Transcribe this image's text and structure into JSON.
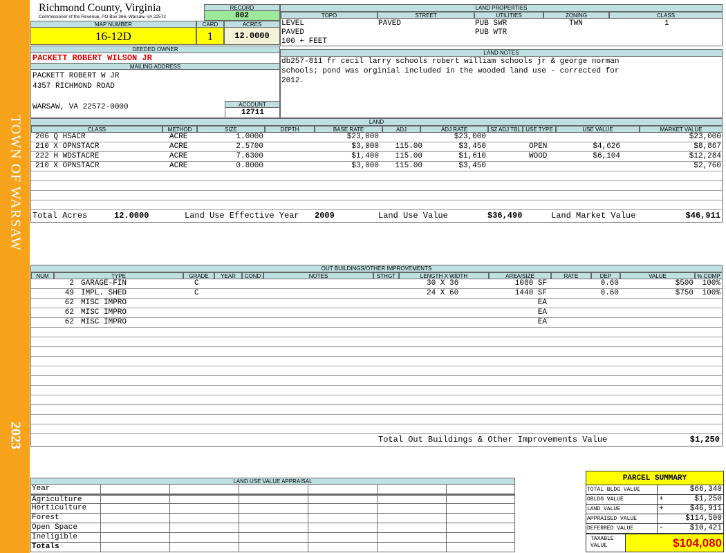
{
  "banner": {
    "town": "TOWN OF WARSAW",
    "year": "2023"
  },
  "header": {
    "county": "Richmond County, Virginia",
    "address": "Commissioner of the Revenue, PO Box 366, Warsaw, VA 22572",
    "record_label": "RECORD",
    "record": "802",
    "map_number_label": "MAP NUMBER",
    "map_number": "16-12D",
    "card_label": "CARD",
    "card": "1",
    "acres_label": "ACRES",
    "acres": "12.0000"
  },
  "owner": {
    "deeded_label": "DEEDED OWNER",
    "name": "PACKETT ROBERT WILSON JR",
    "mailing_label": "MAILING ADDRESS",
    "line1": "PACKETT ROBERT W JR",
    "line2": "4357 RICHMOND ROAD",
    "line3": "WARSAW, VA 22572-0000",
    "account_label": "ACCOUNT",
    "account": "12711"
  },
  "land_properties": {
    "label": "LAND PROPERTIES",
    "headers": [
      "TOPO",
      "STREET",
      "UTILITIES",
      "ZONING",
      "CLASS"
    ],
    "topo": [
      "LEVEL",
      "PAVED",
      "100 + FEET"
    ],
    "street": "PAVED",
    "utilities": [
      "PUB SWR",
      "PUB WTR"
    ],
    "zoning": "TWN",
    "class": "1"
  },
  "land_notes": {
    "label": "LAND NOTES",
    "lines": [
      "db257-811 fr cecil larry schools robert william schools jr & george norman",
      "schools; pond was orginial included in the wooded land use - corrected for",
      "2012."
    ]
  },
  "land": {
    "label": "LAND",
    "headers": [
      "CLASS",
      "METHOD",
      "SIZE",
      "DEPTH",
      "BASE RATE",
      "ADJ",
      "ADJ RATE",
      "SZ ADJ TBL",
      "USE TYPE",
      "USE VALUE",
      "MARKET VALUE"
    ],
    "rows": [
      {
        "class": "206 Q HSACR",
        "method": "ACRE",
        "size": "1.0000",
        "depth": "",
        "base": "$23,000",
        "adj": "",
        "adjrate": "$23,000",
        "sz": "",
        "usetype": "",
        "usevalue": "",
        "market": "$23,000"
      },
      {
        "class": "210 X OPNSTACR",
        "method": "ACRE",
        "size": "2.5700",
        "depth": "",
        "base": "$3,000",
        "adj": "115.00",
        "adjrate": "$3,450",
        "sz": "",
        "usetype": "OPEN",
        "usevalue": "$4,626",
        "market": "$8,867"
      },
      {
        "class": "222 H WDSTACRE",
        "method": "ACRE",
        "size": "7.6300",
        "depth": "",
        "base": "$1,400",
        "adj": "115.00",
        "adjrate": "$1,610",
        "sz": "",
        "usetype": "WOOD",
        "usevalue": "$6,104",
        "market": "$12,284"
      },
      {
        "class": "210 X OPNSTACR",
        "method": "ACRE",
        "size": "0.8000",
        "depth": "",
        "base": "$3,000",
        "adj": "115.00",
        "adjrate": "$3,450",
        "sz": "",
        "usetype": "",
        "usevalue": "",
        "market": "$2,760"
      }
    ],
    "totals": {
      "acres_label": "Total Acres",
      "acres": "12.0000",
      "eff_year_label": "Land Use Effective Year",
      "eff_year": "2009",
      "use_value_label": "Land Use Value",
      "use_value": "$36,490",
      "market_label": "Land Market Value",
      "market": "$46,911"
    }
  },
  "outbuildings": {
    "label": "OUT BUILDINGS/OTHER IMPROVEMENTS",
    "headers": [
      "NUM",
      "TYPE",
      "GRADE",
      "YEAR",
      "COND",
      "NOTES",
      "STHGT",
      "LENGTH X WIDTH",
      "AREA/SIZE",
      "RATE",
      "DEP",
      "VALUE",
      "% COMP"
    ],
    "rows": [
      {
        "num": "2",
        "type": "GARAGE-FIN",
        "grade": "C",
        "lxw": "30 X 36",
        "area": "1080 SF",
        "dep": "0.60",
        "value": "$500",
        "comp": "100%"
      },
      {
        "num": "49",
        "type": "IMPL. SHED",
        "grade": "C",
        "lxw": "24 X 60",
        "area": "1440 SF",
        "dep": "0.60",
        "value": "$750",
        "comp": "100%"
      },
      {
        "num": "62",
        "type": "MISC IMPRO",
        "grade": "",
        "lxw": "",
        "area": "EA",
        "dep": "",
        "value": "",
        "comp": ""
      },
      {
        "num": "62",
        "type": "MISC IMPRO",
        "grade": "",
        "lxw": "",
        "area": "EA",
        "dep": "",
        "value": "",
        "comp": ""
      },
      {
        "num": "62",
        "type": "MISC IMPRO",
        "grade": "",
        "lxw": "",
        "area": "EA",
        "dep": "",
        "value": "",
        "comp": ""
      }
    ],
    "total_label": "Total Out Buildings & Other Improvements Value",
    "total": "$1,250"
  },
  "land_use_appraisal": {
    "label": "LAND USE VALUE APPRAISAL",
    "rows": [
      "Year",
      "Agriculture",
      "Horticulture",
      "Forest",
      "Open Space",
      "Ineligible",
      "Totals"
    ]
  },
  "summary": {
    "title": "PARCEL SUMMARY",
    "rows": [
      {
        "label": "TOTAL BLDG VALUE",
        "sign": "",
        "value": "$66,340"
      },
      {
        "label": "OBLDG VALUE",
        "sign": "+",
        "value": "$1,250"
      },
      {
        "label": "LAND VALUE",
        "sign": "+",
        "value": "$46,911"
      },
      {
        "label": "APPRAISED VALUE",
        "sign": "",
        "value": "$114,500"
      },
      {
        "label": "DEFERRED VALUE",
        "sign": "-",
        "value": "$10,421"
      }
    ],
    "taxable_label_1": "TAXABLE",
    "taxable_label_2": "VALUE",
    "taxable": "$104,080"
  },
  "colors": {
    "banner": "#f7a21b",
    "header_band": "#bfe0e3",
    "highlight_yellow": "#ffff00",
    "record_green": "#9ee89a",
    "owner_red": "#e00000"
  }
}
